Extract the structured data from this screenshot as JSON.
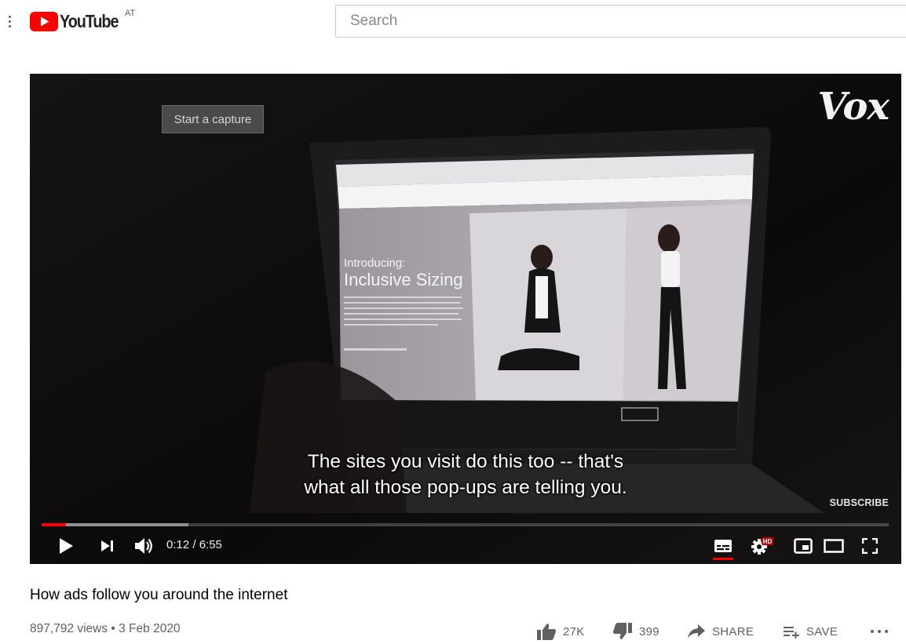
{
  "header": {
    "logo_text": "YouTube",
    "country_code": "AT",
    "search_placeholder": "Search"
  },
  "player": {
    "capture_button": "Start a capture",
    "channel_watermark": "Vox",
    "caption_line1": "The sites you visit do this too -- that's",
    "caption_line2": "what all those pop-ups are telling you.",
    "subscribe_label": "SUBSCRIBE",
    "current_time": "0:12",
    "duration": "6:55",
    "time_display": "0:12 / 6:55",
    "played_fraction": 0.029,
    "loaded_fraction": 0.173,
    "hd_badge": "HD",
    "accent_color": "#ff0000",
    "icons": [
      "play-icon",
      "next-icon",
      "volume-icon",
      "subtitles-icon",
      "settings-icon",
      "miniplayer-icon",
      "theater-icon",
      "fullscreen-icon"
    ]
  },
  "video": {
    "title": "How ads follow you around the internet",
    "meta": "897,792 views • 3 Feb 2020",
    "likes": "27K",
    "dislikes": "399",
    "share_label": "SHARE",
    "save_label": "SAVE"
  }
}
